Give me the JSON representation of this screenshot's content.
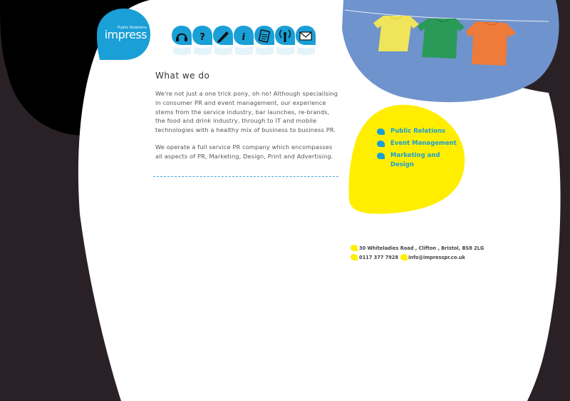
{
  "brand": {
    "tagline": "Public Relations",
    "wordmark": "impress",
    "color_primary": "#1a9fd6",
    "color_accent": "#ffee00",
    "color_dark": "#2a2127",
    "color_sky": "#6f93cc"
  },
  "nav": {
    "items": [
      {
        "icon": "headphones-icon"
      },
      {
        "icon": "question-icon"
      },
      {
        "icon": "pen-icon"
      },
      {
        "icon": "info-icon"
      },
      {
        "icon": "notepad-icon"
      },
      {
        "icon": "broadcast-icon"
      },
      {
        "icon": "envelope-icon"
      }
    ]
  },
  "main": {
    "title": "What we do",
    "paragraph1": "We're not just a one trick pony, oh no! Although specialising in consumer PR and event management, our experience stems from the service industry, bar launches, re-brands, the food and drink industry, through to IT and mobile technologies with a healthy mix of business to business PR.",
    "paragraph2": "We operate a full service PR company which encompasses all aspects of PR, Marketing, Design, Print and Advertising."
  },
  "services": [
    "Public Relations",
    "Event Management",
    "Marketing and Design"
  ],
  "contact": {
    "address": "30 Whiteladies Road , Clifton , Bristol, BS8 2LG",
    "phone": "0117 377 7928",
    "email": "info@impresspr.co.uk"
  }
}
